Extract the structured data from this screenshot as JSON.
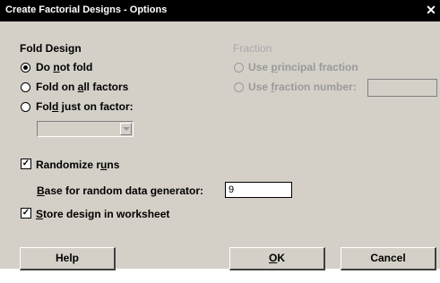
{
  "window": {
    "title": "Create Factorial Designs - Options"
  },
  "fold_design": {
    "heading": "Fold Design",
    "options": [
      {
        "before": "Do ",
        "mnemonic": "n",
        "after": "ot fold",
        "selected": true
      },
      {
        "before": "Fold on ",
        "mnemonic": "a",
        "after": "ll factors",
        "selected": false
      },
      {
        "before": "Fol",
        "mnemonic": "d",
        "after": " just on factor:",
        "selected": false
      }
    ],
    "factor_select_value": ""
  },
  "fraction": {
    "heading": "Fraction",
    "opt1": {
      "before": "Use ",
      "mnemonic": "p",
      "after": "rincipal fraction"
    },
    "opt2": {
      "before": "Use ",
      "mnemonic": "f",
      "after": "raction number:"
    },
    "number_value": ""
  },
  "randomize": {
    "before": "Randomize r",
    "mnemonic": "u",
    "after": "ns",
    "checked": true
  },
  "base": {
    "mnemonic": "B",
    "after": "ase for random data generator:",
    "value": "9"
  },
  "store": {
    "mnemonic": "S",
    "after": "tore design in worksheet",
    "checked": true
  },
  "buttons": {
    "help": "Help",
    "ok_mnemonic": "O",
    "ok_after": "K",
    "cancel": "Cancel"
  },
  "colors": {
    "dialog_bg": "#d4d0c8",
    "titlebar": "#000000",
    "disabled_text": "#9a9a9a"
  }
}
